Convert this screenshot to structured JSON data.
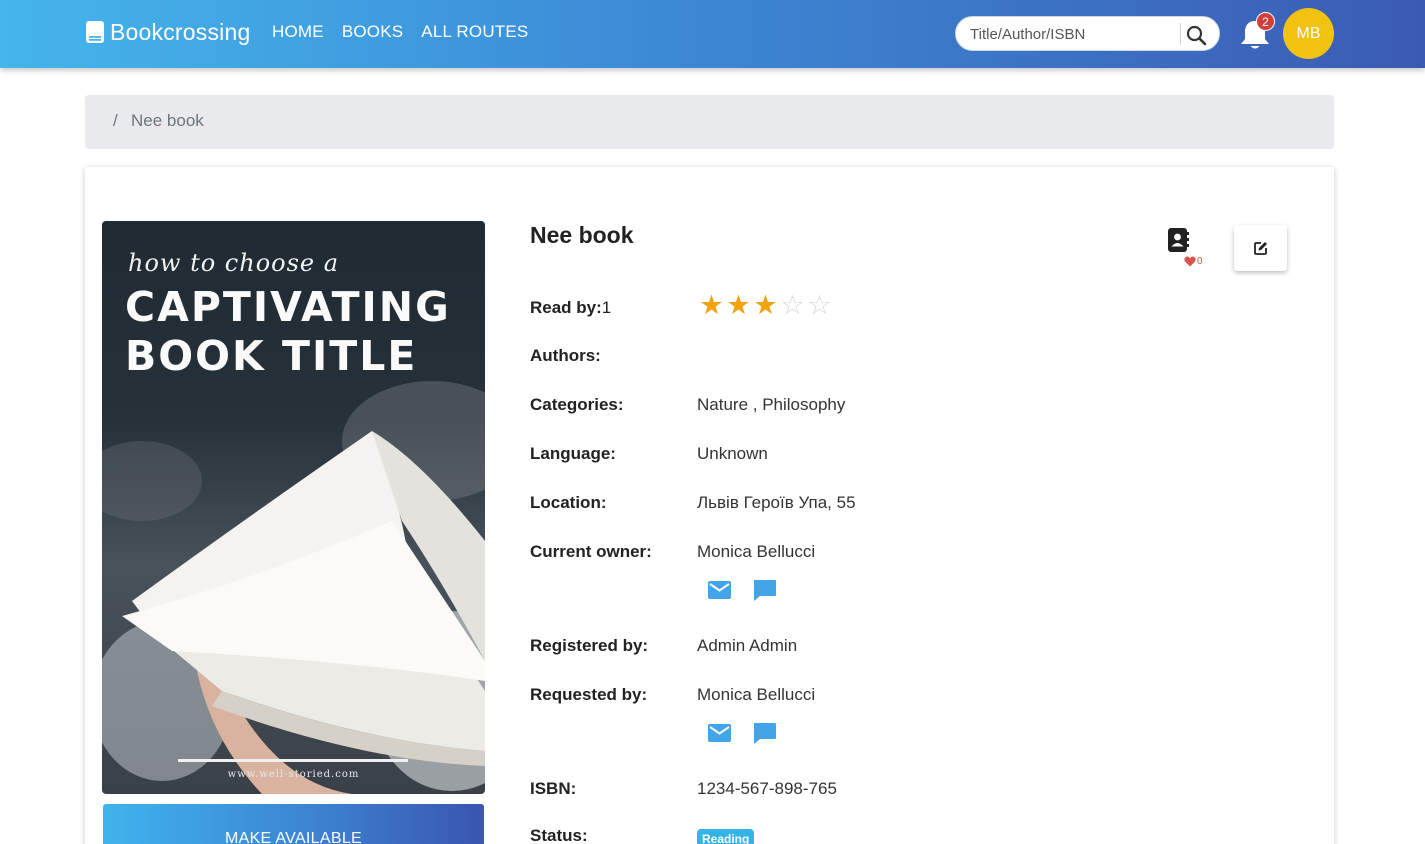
{
  "header": {
    "brand": "Bookcrossing",
    "nav": [
      "HOME",
      "BOOKS",
      "ALL ROUTES"
    ],
    "search_placeholder": "Title/Author/ISBN",
    "notifications_count": "2",
    "avatar_initials": "MB"
  },
  "breadcrumb": {
    "separator": "/",
    "current": "Nee book"
  },
  "cover": {
    "line1": "how to choose a",
    "line2": "CAPTIVATING",
    "line3": "BOOK TITLE",
    "url": "www.well-storied.com"
  },
  "actions": {
    "make_available": "MAKE AVAILABLE",
    "likes_count": "0"
  },
  "book": {
    "title": "Nee book",
    "rating": {
      "value": 3,
      "max": 5
    },
    "fields": {
      "read_by_label": "Read by:",
      "read_by_value": "1",
      "authors_label": "Authors:",
      "categories_label": "Categories:",
      "categories_value": "Nature , Philosophy",
      "language_label": "Language:",
      "language_value": "Unknown",
      "location_label": "Location:",
      "location_value": "Львів Героїв Упа, 55",
      "owner_label": "Current owner:",
      "owner_value": "Monica Bellucci",
      "registered_label": "Registered by:",
      "registered_value": "Admin Admin",
      "requested_label": "Requested by:",
      "requested_value": "Monica Bellucci",
      "isbn_label": "ISBN:",
      "isbn_value": "1234-567-898-765",
      "status_label": "Status:",
      "status_value": "Reading"
    }
  },
  "colors": {
    "accent": "#3c88d5",
    "star": "#f2a20a",
    "avatar": "#f2c211",
    "status": "#35b3e6",
    "icon_blue": "#42a5e8"
  }
}
